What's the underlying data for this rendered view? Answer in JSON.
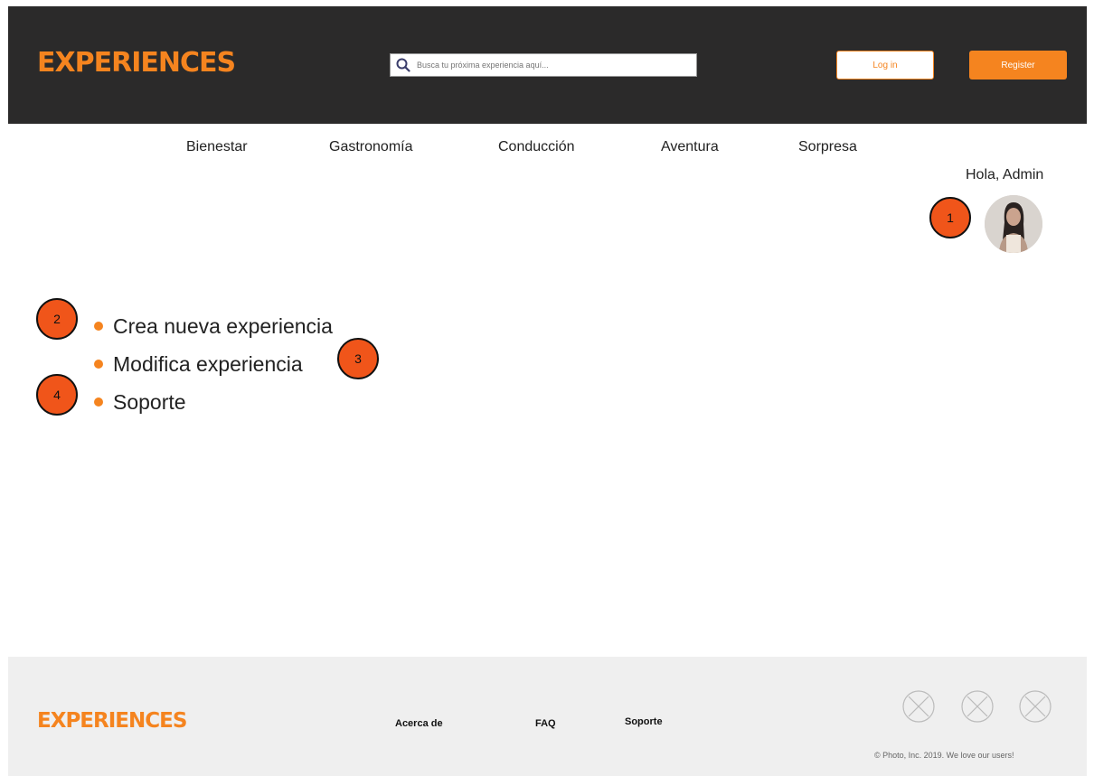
{
  "header": {
    "logo": "EXPERIENCES",
    "search": {
      "placeholder": "Busca tu próxima experiencia aquí..."
    },
    "login_label": "Log in",
    "register_label": "Register"
  },
  "nav": {
    "items": [
      "Bienestar",
      "Gastronomía",
      "Conducción",
      "Aventura",
      "Sorpresa"
    ]
  },
  "user": {
    "greeting": "Hola, Admin"
  },
  "menu": {
    "items": [
      "Crea nueva experiencia",
      "Modifica experiencia",
      "Soporte"
    ]
  },
  "callouts": [
    "1",
    "2",
    "3",
    "4"
  ],
  "footer": {
    "logo": "EXPERIENCES",
    "links": [
      "Acerca de",
      "FAQ",
      "Soporte"
    ],
    "copyright": "© Photo, Inc. 2019. We love our users!"
  },
  "colors": {
    "accent": "#f5841f",
    "header_bg": "#2b2a2a",
    "callout": "#f0551a",
    "footer_bg": "#efefef"
  },
  "icons": [
    "search-icon",
    "avatar",
    "social-icon-placeholder"
  ]
}
